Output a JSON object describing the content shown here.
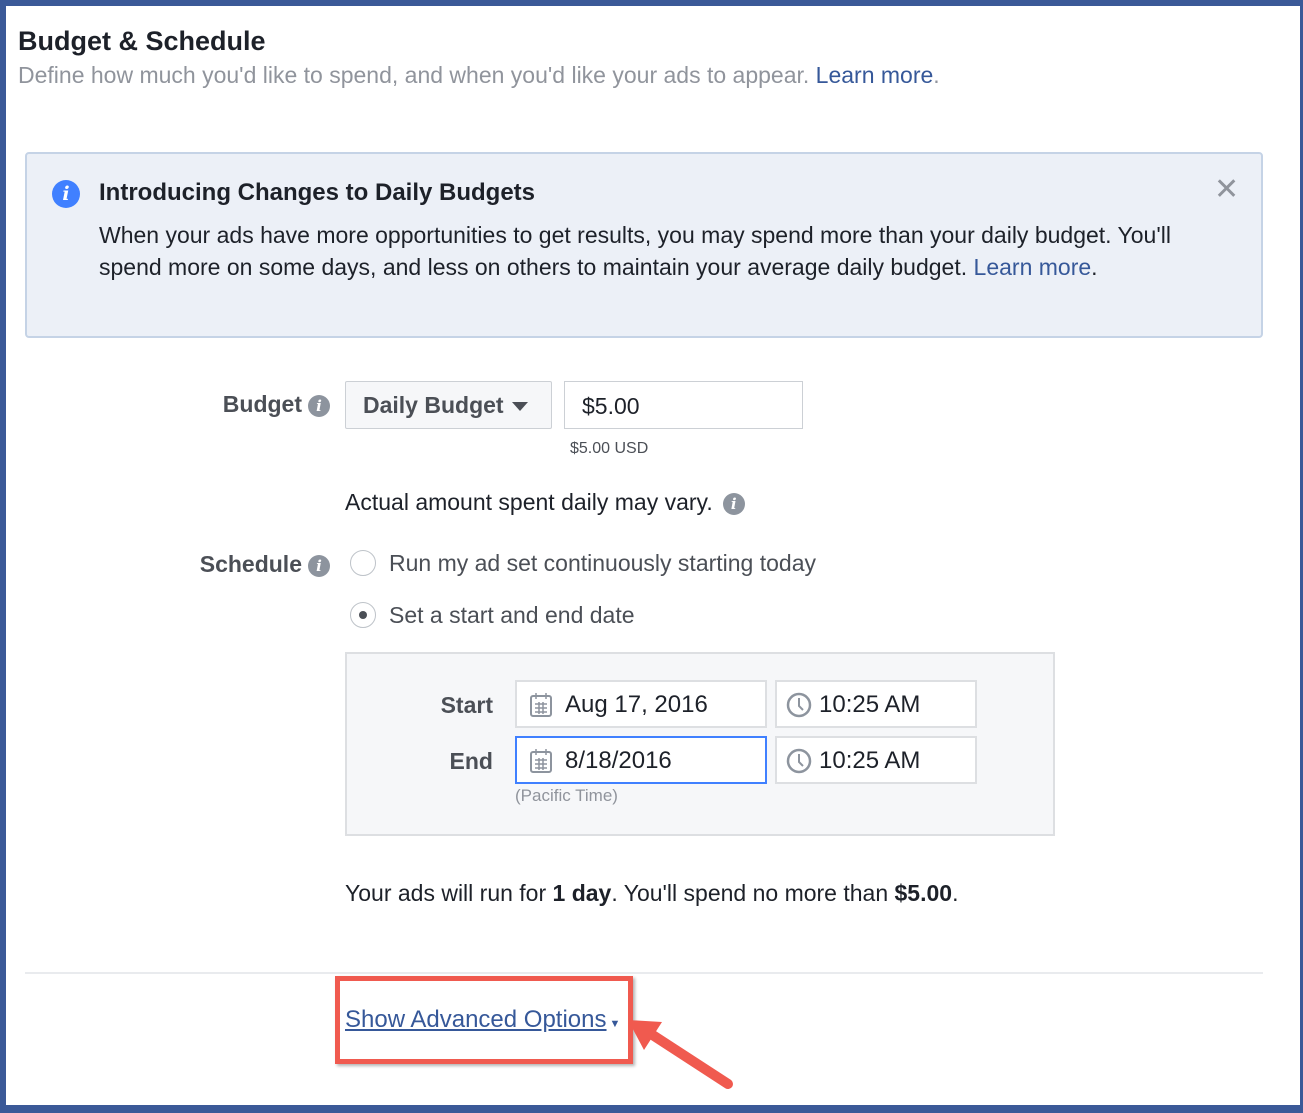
{
  "header": {
    "title": "Budget & Schedule",
    "subtitle": "Define how much you'd like to spend, and when you'd like your ads to appear.",
    "learn_more": "Learn more",
    "period": "."
  },
  "notice": {
    "title": "Introducing Changes to Daily Budgets",
    "body": "When your ads have more opportunities to get results, you may spend more than your daily budget. You'll spend more on some days, and less on others to maintain your average daily budget. ",
    "learn_more": "Learn more",
    "period": ".",
    "icon": "info-icon",
    "close_icon": "close-icon",
    "info_glyph": "i",
    "close_glyph": "✕"
  },
  "budget": {
    "label": "Budget",
    "type_selected": "Daily Budget",
    "amount": "$5.00",
    "amount_usd": "$5.00 USD",
    "note": "Actual amount spent daily may vary."
  },
  "schedule": {
    "label": "Schedule",
    "options": [
      {
        "label": "Run my ad set continuously starting today",
        "selected": false
      },
      {
        "label": "Set a start and end date",
        "selected": true
      }
    ],
    "start_label": "Start",
    "start_date": "Aug 17, 2016",
    "start_time": "10:25 AM",
    "end_label": "End",
    "end_date": "8/18/2016",
    "end_time": "10:25 AM",
    "timezone": "(Pacific Time)"
  },
  "summary": {
    "pre": "Your ads will run for ",
    "duration": "1 day",
    "mid": ". You'll spend no more than ",
    "amount": "$5.00",
    "post": "."
  },
  "advanced": {
    "label": "Show Advanced Options"
  },
  "colors": {
    "frame": "#3b5998",
    "link": "#365899",
    "highlight": "#f05a4f",
    "info": "#4080ff"
  }
}
